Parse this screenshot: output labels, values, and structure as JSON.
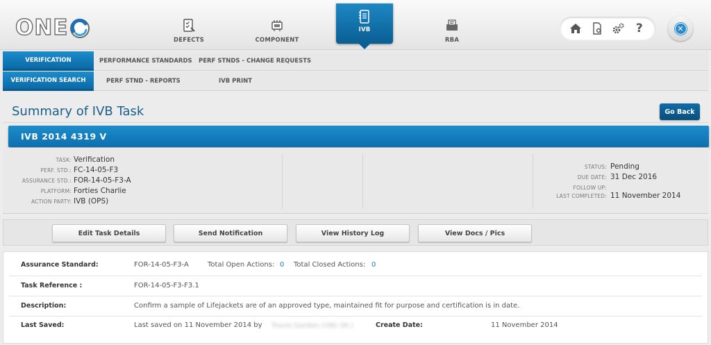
{
  "app": {
    "logo_text": "ONE"
  },
  "nav": {
    "items": [
      {
        "label": "DEFECTS",
        "icon": "defects-icon"
      },
      {
        "label": "COMPONENT",
        "icon": "component-icon"
      },
      {
        "label": "IVB",
        "icon": "ivb-icon",
        "active": true
      },
      {
        "label": "RBA",
        "icon": "rba-icon"
      }
    ]
  },
  "utilities": [
    "home-icon",
    "document-settings-icon",
    "gears-icon",
    "help-icon"
  ],
  "subnav1": {
    "tabs": [
      {
        "label": "VERIFICATION",
        "active": true
      },
      {
        "label": "PERFORMANCE STANDARDS"
      },
      {
        "label": "PERF STNDS - CHANGE REQUESTS"
      }
    ]
  },
  "subnav2": {
    "tabs": [
      {
        "label": "VERIFICATION SEARCH",
        "active": true
      },
      {
        "label": "PERF STND - REPORTS"
      },
      {
        "label": "IVB PRINT"
      }
    ]
  },
  "page": {
    "title": "Summary of IVB Task",
    "go_back_label": "Go Back",
    "record_title": "IVB 2014 4319 V"
  },
  "info_left": [
    {
      "label": "TASK:",
      "value": "Verification"
    },
    {
      "label": "PERF. STD.:",
      "value": "FC-14-05-F3"
    },
    {
      "label": "ASSURANCE STD.:",
      "value": "FOR-14-05-F3-A"
    },
    {
      "label": "PLATFORM:",
      "value": "Forties Charlie"
    },
    {
      "label": "ACTION PARTY:",
      "value": "IVB (OPS)"
    }
  ],
  "info_right": [
    {
      "label": "STATUS:",
      "value": "Pending"
    },
    {
      "label": "DUE DATE:",
      "value": "31 Dec 2016"
    },
    {
      "label": "FOLLOW UP:",
      "value": ""
    },
    {
      "label": "LAST COMPLETED:",
      "value": "11 November 2014"
    }
  ],
  "actions": {
    "edit": "Edit Task Details",
    "notify": "Send Notification",
    "history": "View History Log",
    "docs": "View Docs / Pics"
  },
  "details": {
    "assurance_label": "Assurance Standard:",
    "assurance_value": "FOR-14-05-F3-A",
    "open_actions_label": "Total Open Actions:",
    "open_actions_value": "0",
    "closed_actions_label": "Total Closed Actions:",
    "closed_actions_value": "0",
    "task_ref_label": "Task Reference :",
    "task_ref_value": "FOR-14-05-F3-F3.1",
    "description_label": "Description:",
    "description_value": "Confirm a sample of Lifejackets are of an approved type, maintained fit for purpose and certification is in date.",
    "last_saved_label": "Last Saved:",
    "last_saved_value": "Last saved on 11 November 2014 by",
    "last_saved_user": "Travis Garden (ON) (M.)",
    "create_date_label": "Create Date:",
    "create_date_value": "11 November 2014"
  },
  "colors": {
    "accent": "#0e6fae",
    "link": "#1d7bc4",
    "title": "#1a5f8a"
  }
}
